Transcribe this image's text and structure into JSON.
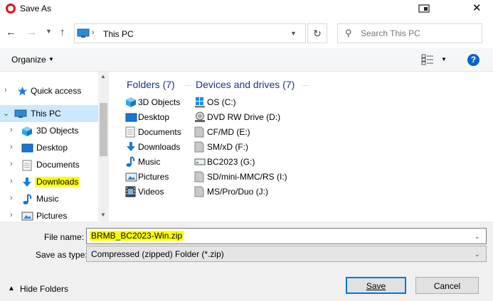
{
  "window": {
    "title": "Save As"
  },
  "address": {
    "path": "This PC"
  },
  "search": {
    "placeholder": "Search This PC"
  },
  "toolbar": {
    "organize": "Organize"
  },
  "nav": {
    "items": [
      {
        "label": "Quick access",
        "icon": "star-icon"
      },
      {
        "label": "This PC",
        "icon": "computer-icon",
        "selected": true
      },
      {
        "label": "3D Objects",
        "icon": "cube-icon"
      },
      {
        "label": "Desktop",
        "icon": "desktop-icon"
      },
      {
        "label": "Documents",
        "icon": "document-icon"
      },
      {
        "label": "Downloads",
        "icon": "download-icon",
        "highlighted": true
      },
      {
        "label": "Music",
        "icon": "music-icon"
      },
      {
        "label": "Pictures",
        "icon": "pictures-icon"
      }
    ]
  },
  "folders": {
    "header": "Folders (7)",
    "items": [
      "3D Objects",
      "Desktop",
      "Documents",
      "Downloads",
      "Music",
      "Pictures",
      "Videos"
    ]
  },
  "devices": {
    "header": "Devices and drives (7)",
    "items": [
      "OS (C:)",
      "DVD RW Drive (D:)",
      "CF/MD (E:)",
      "SM/xD (F:)",
      "BC2023 (G:)",
      "SD/mini-MMC/RS (I:)",
      "MS/Pro/Duo (J:)"
    ]
  },
  "form": {
    "file_name_label": "File name:",
    "file_name_value": "BRMB_BC2023-Win.zip",
    "type_label": "Save as type:",
    "type_value": "Compressed (zipped) Folder (*.zip)"
  },
  "buttons": {
    "hide_folders": "Hide Folders",
    "save": "Save",
    "cancel": "Cancel"
  },
  "colors": {
    "accent": "#0078d7",
    "selection": "#cce8ff",
    "highlight": "#ffff00",
    "section_header": "#1e3287"
  }
}
